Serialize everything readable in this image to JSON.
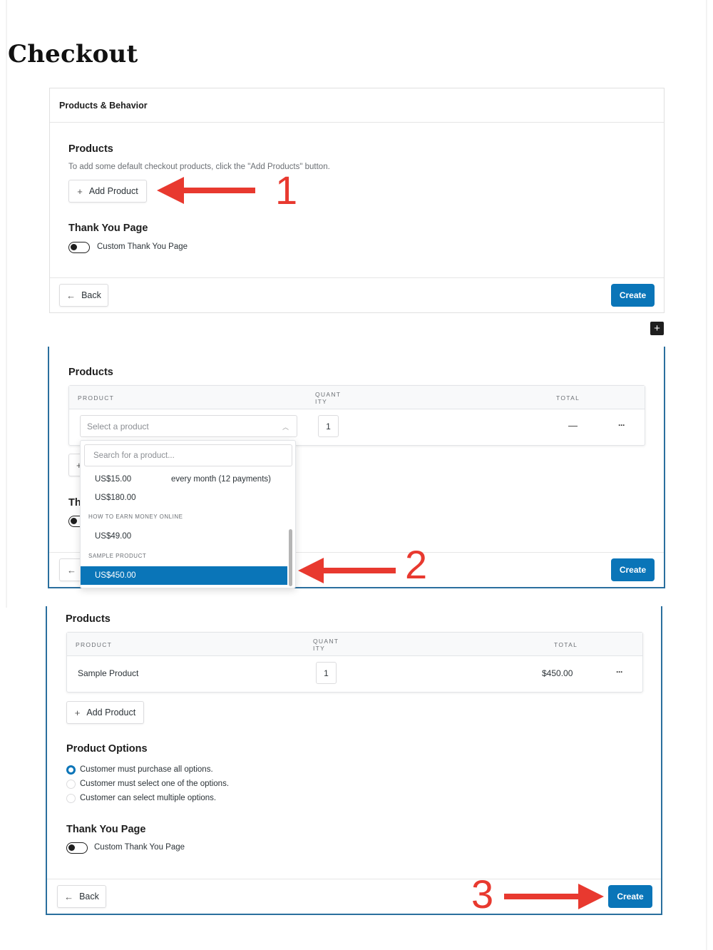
{
  "page": {
    "title": "Checkout"
  },
  "colors": {
    "primary": "#0a75b8",
    "annotation": "#e8392f"
  },
  "step1": {
    "card_header": "Products & Behavior",
    "products_heading": "Products",
    "products_help": "To add some default checkout products, click the \"Add Products\" button.",
    "add_product_label": "Add Product",
    "thank_you_heading": "Thank You Page",
    "toggle_label": "Custom Thank You Page",
    "toggle_on": false,
    "back_label": "Back",
    "create_label": "Create",
    "annotation": "1"
  },
  "add_block_icon": "+",
  "step2": {
    "products_heading": "Products",
    "table_headers": {
      "product": "PRODUCT",
      "quantity": "QUANT ITY",
      "total": "TOTAL"
    },
    "select_placeholder": "Select a product",
    "quantity": "1",
    "total": "—",
    "more_icon": "···",
    "partial_heading": "Th",
    "dropdown": {
      "search_placeholder": "Search for a product...",
      "items": [
        {
          "type": "option",
          "price": "US$15.00",
          "extra": "every month (12 payments)",
          "selected": false
        },
        {
          "type": "option",
          "price": "US$180.00",
          "extra": "",
          "selected": false
        },
        {
          "type": "group",
          "label": "HOW TO EARN MONEY ONLINE"
        },
        {
          "type": "option",
          "price": "US$49.00",
          "extra": "",
          "selected": false
        },
        {
          "type": "group",
          "label": "SAMPLE PRODUCT"
        },
        {
          "type": "option",
          "price": "US$450.00",
          "extra": "",
          "selected": true
        }
      ]
    },
    "create_label": "Create",
    "annotation": "2"
  },
  "step3": {
    "products_heading": "Products",
    "table_headers": {
      "product": "PRODUCT",
      "quantity": "QUANT ITY",
      "total": "TOTAL"
    },
    "row": {
      "product": "Sample Product",
      "quantity": "1",
      "total": "$450.00"
    },
    "more_icon": "···",
    "add_product_label": "Add Product",
    "options_heading": "Product Options",
    "options": [
      {
        "label": "Customer must purchase all options.",
        "checked": true
      },
      {
        "label": "Customer must select one of the options.",
        "checked": false
      },
      {
        "label": "Customer can select multiple options.",
        "checked": false
      }
    ],
    "thank_you_heading": "Thank You Page",
    "toggle_label": "Custom Thank You Page",
    "toggle_on": false,
    "back_label": "Back",
    "create_label": "Create",
    "annotation": "3"
  }
}
